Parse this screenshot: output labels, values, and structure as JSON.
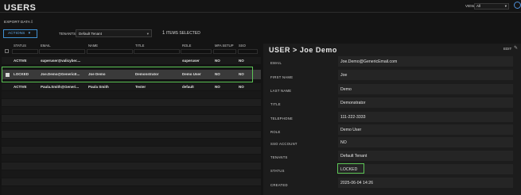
{
  "header": {
    "title": "USERS",
    "view_label": "VIEW",
    "view_value": "All"
  },
  "toolbar": {
    "export": "EXPORT DATA",
    "actions": "ACTIONS",
    "tenants_label": "TENANTS",
    "tenant_value": "Default Tenant",
    "items_count": "1",
    "items_selected": "ITEMS SELECTED"
  },
  "table": {
    "columns": [
      "STATUS",
      "EMAIL",
      "NAME",
      "TITLE",
      "ROLE",
      "MFA SETUP",
      "SSO"
    ],
    "rows": [
      {
        "status": "ACTIVE",
        "email": "superuser@valicyber....",
        "name": "",
        "title": "",
        "role": "superuser",
        "mfa": "NO",
        "sso": "NO"
      },
      {
        "status": "LOCKED",
        "email": "Joe.Demo@GenericE...",
        "name": "Joe Demo",
        "title": "Demonstrator",
        "role": "Demo User",
        "mfa": "NO",
        "sso": "NO"
      },
      {
        "status": "ACTIVE",
        "email": "Paula.Smith@Generi...",
        "name": "Paula Smith",
        "title": "Tester",
        "role": "default",
        "mfa": "NO",
        "sso": "NO"
      }
    ]
  },
  "detail": {
    "crumb": "USER",
    "sep": ">",
    "name": "Joe Demo",
    "edit": "EDIT",
    "fields": [
      {
        "label": "EMAIL",
        "value": "Joe.Demo@GenericEmail.com"
      },
      {
        "label": "FIRST NAME",
        "value": "Joe"
      },
      {
        "label": "LAST NAME",
        "value": "Demo"
      },
      {
        "label": "TITLE",
        "value": "Demonstrator"
      },
      {
        "label": "TELEPHONE",
        "value": "111-222-3333"
      },
      {
        "label": "ROLE",
        "value": "Demo User"
      },
      {
        "label": "SSO ACCOUNT",
        "value": "NO"
      },
      {
        "label": "TENANTS",
        "value": "Default Tenant"
      },
      {
        "label": "STATUS",
        "value": "LOCKED"
      },
      {
        "label": "CREATED",
        "value": "2025-06-04 14:26"
      }
    ]
  },
  "colors": {
    "accent": "#3f8fd0",
    "highlight": "#5cc455"
  },
  "icons": [
    "settings-icon",
    "export-icon",
    "chevron-down-icon",
    "edit-pencil-icon",
    "checkbox-icon"
  ]
}
